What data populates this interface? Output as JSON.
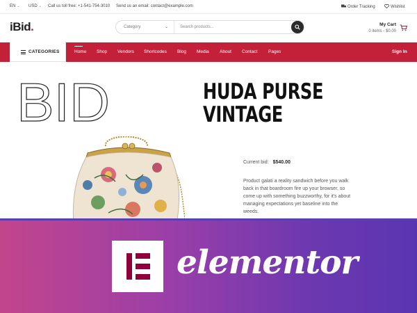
{
  "topbar": {
    "language": "EN",
    "currency": "USD",
    "phone": "Call us toll free: +1-541-754-3010",
    "email": "Send us an email: contact@example.com",
    "order_tracking": "Order Tracking",
    "wishlist": "Wishlist"
  },
  "header": {
    "logo_main": "iBid",
    "logo_dot": ".",
    "search_category": "Category",
    "search_placeholder": "Search products...",
    "cart_title": "My Cart",
    "cart_summary": "0 items - $0.00"
  },
  "nav": {
    "categories_label": "CATEGORIES",
    "links": [
      "Home",
      "Shop",
      "Vendors",
      "Shortcodes",
      "Blog",
      "Media",
      "About",
      "Contact",
      "Pages"
    ],
    "signin": "Sign In"
  },
  "hero": {
    "big_word": "BID",
    "title_line1": "Huda Purse",
    "title_line2": "Vintage",
    "current_bid_label": "Current bid:",
    "current_bid_value": "$540.00",
    "description": "Product galati a reality sandwich before you walk back in that boardroom fire up your browser, so come up with something buzzworthy, for it's about managing expectations yet baseline into the weeds."
  },
  "banner": {
    "wordmark": "elementor"
  },
  "colors": {
    "brand": "#c3203a",
    "elementor": "#92003b"
  },
  "icons": [
    "chevron-down-icon",
    "search-icon",
    "cart-icon",
    "truck-icon",
    "heart-icon",
    "menu-icon",
    "elementor-logo-icon"
  ]
}
